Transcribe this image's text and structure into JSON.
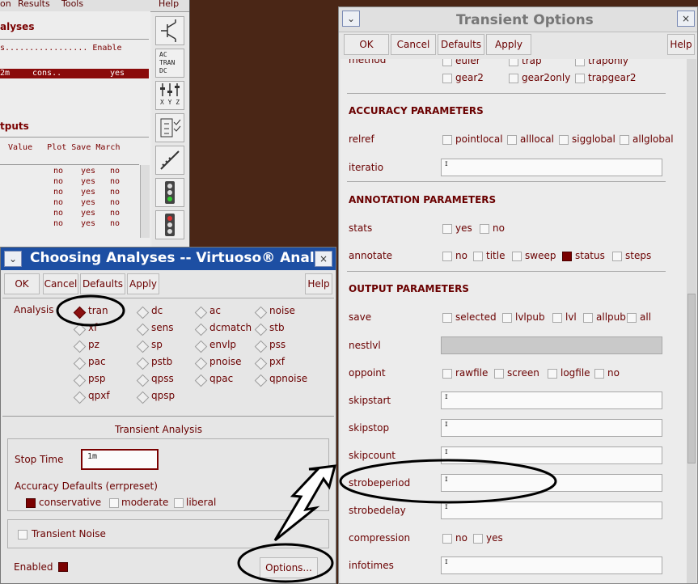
{
  "back_window": {
    "menu": [
      "on",
      "Results",
      "Tools",
      "Help"
    ],
    "analyses_header": "alyses",
    "analyses_row_text": "s................. Enable",
    "selected_row": {
      "c1": "2m",
      "c2": "cons..",
      "c3": "yes"
    },
    "outputs_header": "tputs",
    "outputs_columns": "Value   Plot Save March",
    "output_rows": [
      {
        "plot": "no",
        "save": "yes",
        "march": "no"
      },
      {
        "plot": "no",
        "save": "yes",
        "march": "no"
      },
      {
        "plot": "no",
        "save": "yes",
        "march": "no"
      },
      {
        "plot": "no",
        "save": "yes",
        "march": "no"
      },
      {
        "plot": "no",
        "save": "yes",
        "march": "no"
      },
      {
        "plot": "no",
        "save": "yes",
        "march": "no"
      }
    ],
    "toolbar_acdc": [
      "AC",
      "TRAN",
      "DC"
    ],
    "toolbar_xyz": "X Y Z"
  },
  "choosing_analyses": {
    "title": "Choosing Analyses -- Virtuoso® Anal",
    "close_glyph": "×",
    "menu_glyph": "⌄",
    "buttons": {
      "ok": "OK",
      "cancel": "Cancel",
      "defaults": "Defaults",
      "apply": "Apply",
      "help": "Help"
    },
    "analysis_label": "Analysis",
    "analyses": [
      "tran",
      "dc",
      "ac",
      "noise",
      "xf",
      "sens",
      "dcmatch",
      "stb",
      "pz",
      "sp",
      "envlp",
      "pss",
      "pac",
      "pstb",
      "pnoise",
      "pxf",
      "psp",
      "qpss",
      "qpac",
      "qpnoise",
      "qpxf",
      "qpsp"
    ],
    "selected_analysis": "tran",
    "section_title": "Transient Analysis",
    "stop_time_label": "Stop Time",
    "stop_time_value": "1m",
    "accuracy_label": "Accuracy Defaults (errpreset)",
    "accuracy_options": [
      "conservative",
      "moderate",
      "liberal"
    ],
    "accuracy_selected": "conservative",
    "transient_noise_label": "Transient Noise",
    "enabled_label": "Enabled",
    "options_button": "Options..."
  },
  "transient_options": {
    "title": "Transient Options",
    "close_glyph": "×",
    "menu_glyph": "⌄",
    "buttons": {
      "ok": "OK",
      "cancel": "Cancel",
      "defaults": "Defaults",
      "apply": "Apply",
      "help": "Help"
    },
    "method_label": "method",
    "method_options": [
      "euler",
      "trap",
      "traponly",
      "gear2",
      "gear2only",
      "trapgear2"
    ],
    "accuracy_section": "ACCURACY PARAMETERS",
    "relref_label": "relref",
    "relref_options": [
      "pointlocal",
      "alllocal",
      "sigglobal",
      "allglobal"
    ],
    "iteratio_label": "iteratio",
    "annotation_section": "ANNOTATION PARAMETERS",
    "stats_label": "stats",
    "stats_options": [
      "yes",
      "no"
    ],
    "annotate_label": "annotate",
    "annotate_options": [
      "no",
      "title",
      "sweep",
      "status",
      "steps"
    ],
    "annotate_selected": "status",
    "output_section": "OUTPUT PARAMETERS",
    "save_label": "save",
    "save_options": [
      "selected",
      "lvlpub",
      "lvl",
      "allpub",
      "all"
    ],
    "nestlvl_label": "nestlvl",
    "oppoint_label": "oppoint",
    "oppoint_options": [
      "rawfile",
      "screen",
      "logfile",
      "no"
    ],
    "skipstart_label": "skipstart",
    "skipstop_label": "skipstop",
    "skipcount_label": "skipcount",
    "strobeperiod_label": "strobeperiod",
    "strobedelay_label": "strobedelay",
    "compression_label": "compression",
    "compression_options": [
      "no",
      "yes"
    ],
    "infotimes_label": "infotimes"
  },
  "colors": {
    "accent": "#7a0000",
    "title_bar": "#1d4fa3",
    "background": "#4a2616"
  }
}
